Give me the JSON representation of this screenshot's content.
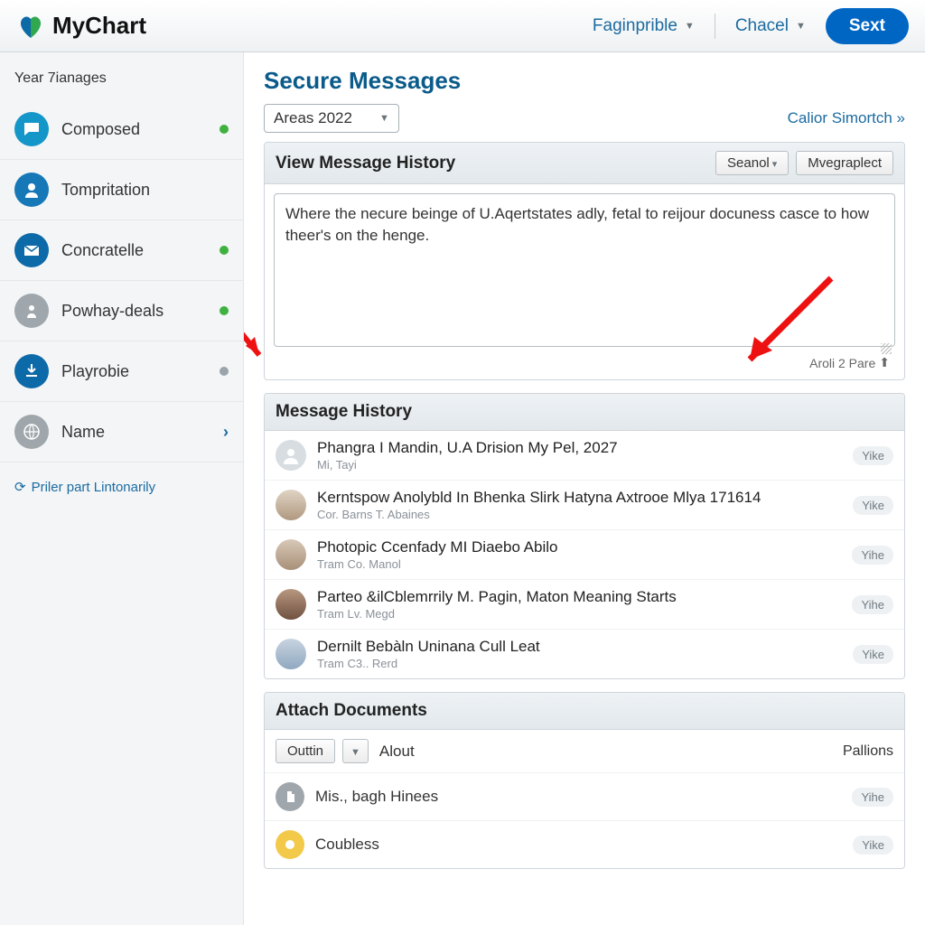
{
  "brand": "MyChart",
  "top": {
    "link1": "Faginprible",
    "link2": "Chacel",
    "cta": "Sext"
  },
  "sidebar": {
    "heading": "Year 7ianages",
    "items": [
      {
        "label": "Composed",
        "icon": "chat",
        "icon_bg": "#1596c8",
        "dot": "green"
      },
      {
        "label": "Tompritation",
        "icon": "person",
        "icon_bg": "#1778b8",
        "dot": "none"
      },
      {
        "label": "Concratelle",
        "icon": "mail",
        "icon_bg": "#0d6aa8",
        "dot": "green"
      },
      {
        "label": "Powhay-deals",
        "icon": "profile",
        "icon_bg": "#9fa7ad",
        "dot": "green"
      },
      {
        "label": "Playrobie",
        "icon": "download",
        "icon_bg": "#0d6aa8",
        "dot": "grey"
      },
      {
        "label": "Name",
        "icon": "globe",
        "icon_bg": "#9fa7ad",
        "dot": "chev"
      }
    ],
    "footer": "Priler part Lintonarily"
  },
  "page": {
    "title": "Secure Messages",
    "filter_value": "Areas 2022",
    "right_link": "Calior Simortch »"
  },
  "compose": {
    "panel_title": "View Message History",
    "btn1": "Seanol",
    "btn2": "Mvegraplect",
    "text": "Where the necure beinge of U.Aqertstates adly, fetal to reijour docuness casce to how theer's on the henge.",
    "footer": "Aroli 2 Pare"
  },
  "history": {
    "panel_title": "Message History",
    "items": [
      {
        "title": "Phangra I Mandin, U.A Drision My Pel, 2027",
        "sub": "Mi, Tayi",
        "avatar": "#d7dde1",
        "pill": "Yike"
      },
      {
        "title": "Kerntspow Anolybld In Bhenka Slirk Hatyna Axtrooe Mlya 171614",
        "sub": "Cor. Barns T. Abaines",
        "avatar": "#c9b8a8",
        "pill": "Yike"
      },
      {
        "title": "Photopic Ccenfady MI Diaebo Abilo",
        "sub": "Tram Co. Manol",
        "avatar": "#b8a898",
        "pill": "Yihe"
      },
      {
        "title": "Parteo &ilCblemrrily M. Pagin, Maton Meaning Starts",
        "sub": "Tram Lv. Megd",
        "avatar": "#a08878",
        "pill": "Yihe"
      },
      {
        "title": "Dernilt Bebàln Uninana Cull Leat",
        "sub": "Tram C3.. Rerd",
        "avatar": "#b0c0d0",
        "pill": "Yike"
      }
    ]
  },
  "attach": {
    "panel_title": "Attach Documents",
    "btn": "Outtin",
    "label": "Alout",
    "right": "Pallions",
    "docs": [
      {
        "name": "Mis., bagh Hinees",
        "icon_bg": "#9fa7ad",
        "pill": "Yihe"
      },
      {
        "name": "Coubless",
        "icon_bg": "#f3c94a",
        "pill": "Yike"
      }
    ]
  }
}
